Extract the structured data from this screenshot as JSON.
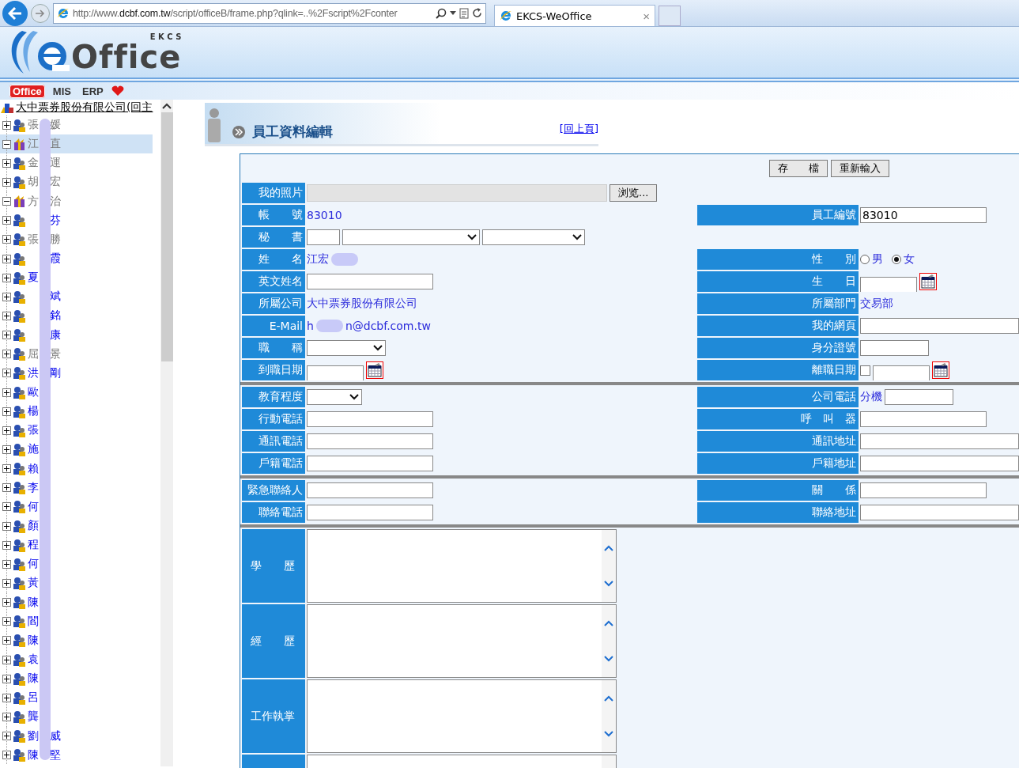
{
  "browser": {
    "url": "http://www.**dcbf.com.tw**/script/officeB/frame.php?qlink=..%2Fscript%2Fconter",
    "tab_title": "EKCS-WeOffice",
    "tab_close": "×"
  },
  "header": {
    "logo_word": "Office",
    "logo_sub": "E K C S"
  },
  "modules": [
    {
      "label": "Office",
      "selected": true
    },
    {
      "label": "MIS",
      "selected": false
    },
    {
      "label": "ERP",
      "selected": false
    }
  ],
  "tree": {
    "root": "大中票券股份有限公司(回主",
    "items": [
      {
        "start": "張",
        "end": "媛",
        "visited": true,
        "expanded": false,
        "selected": false
      },
      {
        "start": "江",
        "end": "直",
        "visited": true,
        "expanded": true,
        "selected": true
      },
      {
        "start": "金",
        "end": "運",
        "visited": true,
        "expanded": false,
        "selected": false
      },
      {
        "start": "胡",
        "end": "宏",
        "visited": true,
        "expanded": false,
        "selected": false
      },
      {
        "start": "方",
        "end": "治",
        "visited": true,
        "expanded": true,
        "selected": false
      },
      {
        "end": "芬",
        "visited": false,
        "expanded": false,
        "selected": false
      },
      {
        "start": "張",
        "end": "勝",
        "visited": true,
        "expanded": false,
        "selected": false
      },
      {
        "end": "霞",
        "visited": false,
        "expanded": false,
        "selected": false
      },
      {
        "start": "夏",
        "visited": false,
        "expanded": false,
        "selected": false
      },
      {
        "end": "斌",
        "visited": false,
        "expanded": false,
        "selected": false
      },
      {
        "end": "銘",
        "visited": false,
        "expanded": false,
        "selected": false
      },
      {
        "end": "康",
        "visited": false,
        "expanded": false,
        "selected": false
      },
      {
        "start": "屈",
        "end": "景",
        "visited": true,
        "expanded": false,
        "selected": false
      },
      {
        "start": "洪",
        "end": "剛",
        "visited": false,
        "expanded": false,
        "selected": false
      },
      {
        "start": "歐",
        "visited": false,
        "expanded": false,
        "selected": false
      },
      {
        "start": "楊",
        "visited": false,
        "expanded": false,
        "selected": false
      },
      {
        "start": "張",
        "visited": false,
        "expanded": false,
        "selected": false
      },
      {
        "start": "施",
        "visited": false,
        "expanded": false,
        "selected": false
      },
      {
        "start": "賴",
        "visited": false,
        "expanded": false,
        "selected": false
      },
      {
        "start": "李",
        "visited": false,
        "expanded": false,
        "selected": false
      },
      {
        "start": "何",
        "visited": false,
        "expanded": false,
        "selected": false
      },
      {
        "start": "顏",
        "visited": false,
        "expanded": false,
        "selected": false
      },
      {
        "start": "程",
        "visited": false,
        "expanded": false,
        "selected": false
      },
      {
        "start": "何",
        "visited": false,
        "expanded": false,
        "selected": false
      },
      {
        "start": "黃",
        "visited": false,
        "expanded": false,
        "selected": false
      },
      {
        "start": "陳",
        "visited": false,
        "expanded": false,
        "selected": false
      },
      {
        "start": "閻",
        "visited": false,
        "expanded": false,
        "selected": false
      },
      {
        "start": "陳",
        "visited": false,
        "expanded": false,
        "selected": false
      },
      {
        "start": "袁",
        "visited": false,
        "expanded": false,
        "selected": false
      },
      {
        "start": "陳",
        "visited": false,
        "expanded": false,
        "selected": false
      },
      {
        "start": "呂",
        "visited": false,
        "expanded": false,
        "selected": false
      },
      {
        "start": "龔",
        "visited": false,
        "expanded": false,
        "selected": false
      },
      {
        "start": "劉",
        "end": "威",
        "visited": false,
        "expanded": false,
        "selected": false
      },
      {
        "start": "陳",
        "end": "堅",
        "visited": false,
        "expanded": false,
        "selected": false
      }
    ]
  },
  "page": {
    "title": "員工資料編輯",
    "back_link": "[回上頁]"
  },
  "actions": [
    "存　　檔",
    "重新輸入"
  ],
  "sections": [
    [
      {
        "left": {
          "label": "我的照片",
          "parts": [
            {
              "kind": "file"
            },
            {
              "kind": "browse-button",
              "label": "浏览..."
            }
          ]
        }
      },
      {
        "left": {
          "label": "帳　　號",
          "parts": [
            {
              "kind": "text",
              "text": "83010"
            }
          ]
        },
        "right": {
          "label": "員工編號",
          "parts": [
            {
              "kind": "input",
              "value": "83010"
            }
          ]
        }
      },
      {
        "left": {
          "label": "秘　　書",
          "parts": [
            {
              "kind": "tiny-input"
            },
            {
              "kind": "wide-select"
            },
            {
              "kind": "mid-select"
            }
          ]
        }
      },
      {
        "left": {
          "label": "姓　　名",
          "parts": [
            {
              "kind": "text",
              "text": "江宏"
            },
            {
              "kind": "blur"
            }
          ]
        },
        "right": {
          "label": "性　　別",
          "parts": [
            {
              "kind": "radio",
              "label": "男",
              "selected": false
            },
            {
              "kind": "radio",
              "label": "女",
              "selected": true
            }
          ]
        }
      },
      {
        "left": {
          "label": "英文姓名",
          "parts": [
            {
              "kind": "input"
            }
          ]
        },
        "right": {
          "label": "生　　日",
          "parts": [
            {
              "kind": "short-input"
            },
            {
              "kind": "calendar"
            }
          ]
        }
      },
      {
        "left": {
          "label": "所屬公司",
          "parts": [
            {
              "kind": "text",
              "text": "大中票券股份有限公司"
            }
          ]
        },
        "right": {
          "label": "所屬部門",
          "parts": [
            {
              "kind": "text",
              "text": "交易部"
            }
          ]
        }
      },
      {
        "left": {
          "label": "E-Mail",
          "parts": [
            {
              "kind": "text",
              "text": "h"
            },
            {
              "kind": "blur"
            },
            {
              "kind": "text",
              "text": "n@dcbf.com.tw"
            }
          ]
        },
        "right": {
          "label": "我的網頁",
          "parts": [
            {
              "kind": "wide-input"
            }
          ]
        }
      },
      {
        "left": {
          "label": "職　　稱",
          "parts": [
            {
              "kind": "select"
            }
          ]
        },
        "right": {
          "label": "身分證號",
          "parts": [
            {
              "kind": "mid-input"
            }
          ]
        }
      },
      {
        "left": {
          "label": "到職日期",
          "parts": [
            {
              "kind": "short-input"
            },
            {
              "kind": "calendar"
            }
          ]
        },
        "right": {
          "label": "離職日期",
          "parts": [
            {
              "kind": "checkbox",
              "checked": false
            },
            {
              "kind": "short-input"
            },
            {
              "kind": "calendar"
            }
          ]
        }
      }
    ],
    [
      {
        "left": {
          "label": "教育程度",
          "parts": [
            {
              "kind": "small-select"
            }
          ]
        },
        "right": {
          "label": "公司電話",
          "parts": [
            {
              "kind": "text",
              "text": "分機"
            },
            {
              "kind": "mid-input"
            }
          ]
        }
      },
      {
        "left": {
          "label": "行動電話",
          "parts": [
            {
              "kind": "input"
            }
          ]
        },
        "right": {
          "label": "呼　叫　器",
          "parts": [
            {
              "kind": "input"
            }
          ]
        }
      },
      {
        "left": {
          "label": "通訊電話",
          "parts": [
            {
              "kind": "input"
            }
          ]
        },
        "right": {
          "label": "通訊地址",
          "parts": [
            {
              "kind": "wide-input"
            }
          ]
        }
      },
      {
        "left": {
          "label": "戶籍電話",
          "parts": [
            {
              "kind": "input"
            }
          ]
        },
        "right": {
          "label": "戶籍地址",
          "parts": [
            {
              "kind": "wide-input"
            }
          ]
        }
      }
    ],
    [
      {
        "left": {
          "label": "緊急聯絡人",
          "parts": [
            {
              "kind": "input"
            }
          ]
        },
        "right": {
          "label": "關　　係",
          "parts": [
            {
              "kind": "input"
            }
          ]
        }
      },
      {
        "left": {
          "label": "聯絡電話",
          "parts": [
            {
              "kind": "input"
            }
          ]
        },
        "right": {
          "label": "聯絡地址",
          "parts": [
            {
              "kind": "wide-input"
            }
          ]
        }
      }
    ]
  ],
  "text_areas": [
    {
      "kind": "textarea",
      "label": "學　　歷"
    },
    {
      "kind": "textarea",
      "label": "經　　歷"
    },
    {
      "kind": "textarea",
      "label": "工作執掌"
    },
    {
      "kind": "textarea"
    }
  ]
}
